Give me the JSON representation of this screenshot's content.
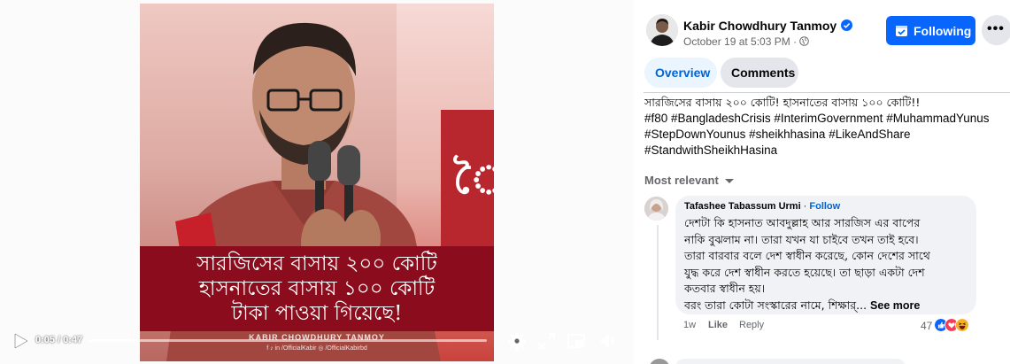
{
  "video": {
    "caption_lines": [
      "সারজিসের বাসায় ২০০ কোটি",
      "হাসনাতের বাসায় ১০০ কোটি",
      "টাকা পাওয়া গিয়েছে!"
    ],
    "watermark": "KABIR CHOWDHURY TANMOY",
    "watermark_sub": "f ♪ in /OfficialKabir ◎ /OfficialKabirbd",
    "current_time": "0:05",
    "duration": "0:47",
    "time_display": "0:05 / 0:47",
    "progress": 0.106,
    "icons": [
      "play-icon",
      "settings-icon",
      "fullscreen-icon",
      "picture-in-picture-icon",
      "volume-icon"
    ]
  },
  "post": {
    "author": "Kabir Chowdhury Tanmoy",
    "verified": true,
    "timestamp": "October 19 at 5:03 PM",
    "timestamp_sep": "·",
    "follow_label": "Following",
    "more_label": "•••",
    "tabs": [
      {
        "label": "Overview",
        "active": true
      },
      {
        "label": "Comments",
        "active": false
      }
    ],
    "text_line": "সারজিসের বাসায় ২০০ কোটি! হাসনাতের বাসায় ১০০ কোটি!!",
    "hashtag_lines": [
      [
        "#f80",
        "#BangladeshCrisis",
        "#InterimGovernment",
        "#MuhammadYunus"
      ],
      [
        "#StepDownYounus",
        "#sheikhhasina",
        "#LikeAndShare"
      ],
      [
        "#StandwithSheikhHasina"
      ]
    ]
  },
  "comments": {
    "sort_label": "Most relevant",
    "items": [
      {
        "author": "Tafashee Tabassum Urmi",
        "separator": "·",
        "follow_label": "Follow",
        "lines": [
          "দেশটা কি হাসনাত আবদুল্লাহ আর সারজিস এর বাপের",
          "নাকি বুঝলাম না। তারা যখন যা চাইবে তখন তাই হবে।",
          "তারা বারবার বলে দেশ স্বাধীন করেছে, কোন দেশের সাথে",
          "যুদ্ধ করে দেশ স্বাধীন করতে হয়েছে। তা ছাড়া একটা দেশ",
          "কতবার স্বাধীন হয়।",
          "বরং তারা কোটা সংস্কারের নামে, শিক্ষার্..."
        ],
        "see_more": "See more",
        "time": "1w",
        "like_label": "Like",
        "reply_label": "Reply",
        "reaction_count": "47",
        "reactions": [
          "like-reaction-icon",
          "love-reaction-icon",
          "haha-reaction-icon"
        ]
      }
    ]
  },
  "colors": {
    "accent": "#0866ff",
    "caption_bg": "#8b0d1d",
    "link": "#0064d1",
    "muted": "#65676b"
  }
}
